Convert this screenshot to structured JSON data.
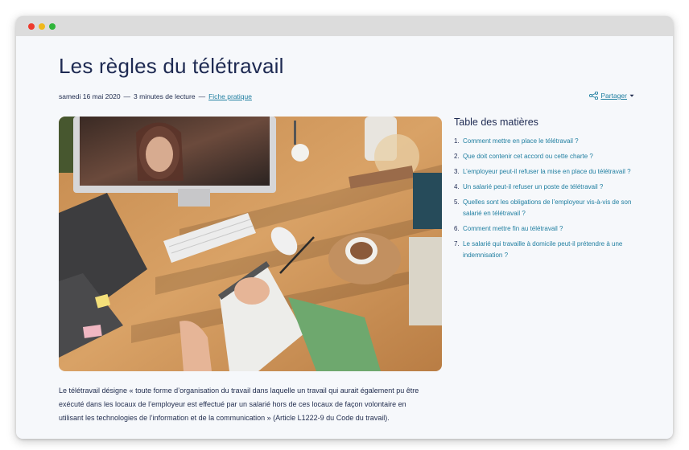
{
  "window": {
    "dots": [
      "#ee3b2e",
      "#f0b81c",
      "#2fb53a"
    ]
  },
  "article": {
    "title": "Les règles du télétravail",
    "meta": {
      "date": "samedi 16 mai 2020",
      "sep1": "—",
      "reading_time": "3 minutes de lecture",
      "sep2": "—",
      "category": "Fiche pratique"
    },
    "share_label": "Partager",
    "intro": "Le télétravail désigne « toute forme d’organisation du travail dans laquelle un travail qui aurait également pu être exécuté dans les locaux de l’employeur est effectué par un salarié hors de ces locaux de façon volontaire en utilisant les technologies de l’information et de la communication » (Article L1222-9 du Code du travail)."
  },
  "toc": {
    "heading": "Table des matières",
    "items": [
      {
        "num": "1.",
        "label": "Comment mettre en place le télétravail ?"
      },
      {
        "num": "2.",
        "label": "Que doit contenir cet accord ou cette charte ?"
      },
      {
        "num": "3.",
        "label": "L’employeur peut-il refuser la mise en place du télétravail ?"
      },
      {
        "num": "4.",
        "label": "Un salarié peut-il refuser un poste de télétravail ?"
      },
      {
        "num": "5.",
        "label": "Quelles sont les obligations de l’employeur vis-à-vis de son salarié en télétravail ?"
      },
      {
        "num": "6.",
        "label": "Comment mettre fin au télétravail ?"
      },
      {
        "num": "7.",
        "label": "Le salarié qui travaille à domicile peut-il prétendre à une indemnisation ?"
      }
    ]
  },
  "colors": {
    "title": "#1e2a52",
    "link": "#1f7ea0",
    "background": "#f6f8fb"
  },
  "icons": {
    "share": "share-icon",
    "caret": "caret-down-icon"
  }
}
